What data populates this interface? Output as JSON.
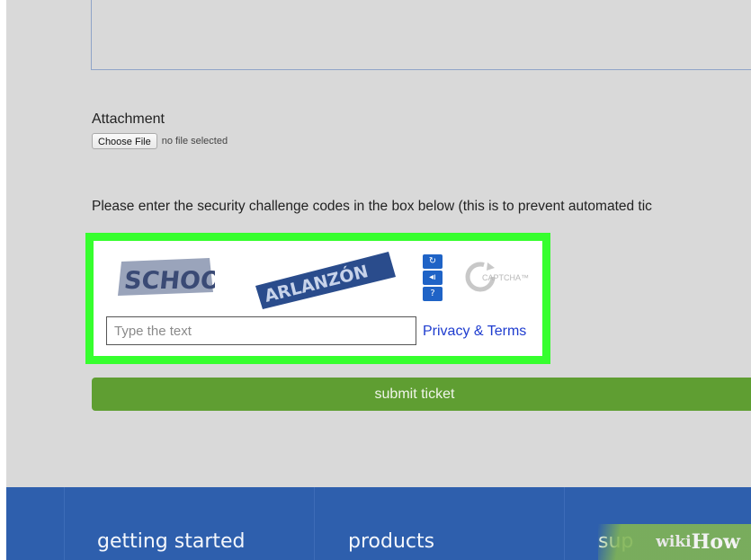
{
  "form": {
    "attachment_label": "Attachment",
    "choose_file_label": "Choose File",
    "file_status": "no file selected",
    "security_instructions": "Please enter the security challenge codes in the box below (this is to prevent automated tic"
  },
  "captcha": {
    "frame_color": "#36ff2e",
    "word_1": "SCHOOI",
    "word_2": "ARLANZÓN",
    "input_placeholder": "Type the text",
    "privacy_terms_label": "Privacy & Terms",
    "reload_icon": "↻",
    "audio_icon": "◂ı",
    "help_icon": "?",
    "logo_text": "CAPTCHA™"
  },
  "actions": {
    "submit_label": "submit ticket",
    "submit_color": "#5f9e32"
  },
  "footer": {
    "background_color": "#2e5fad",
    "links": [
      "getting started",
      "products",
      "sup"
    ]
  },
  "watermark": {
    "wiki": "wiki",
    "how": "How"
  }
}
